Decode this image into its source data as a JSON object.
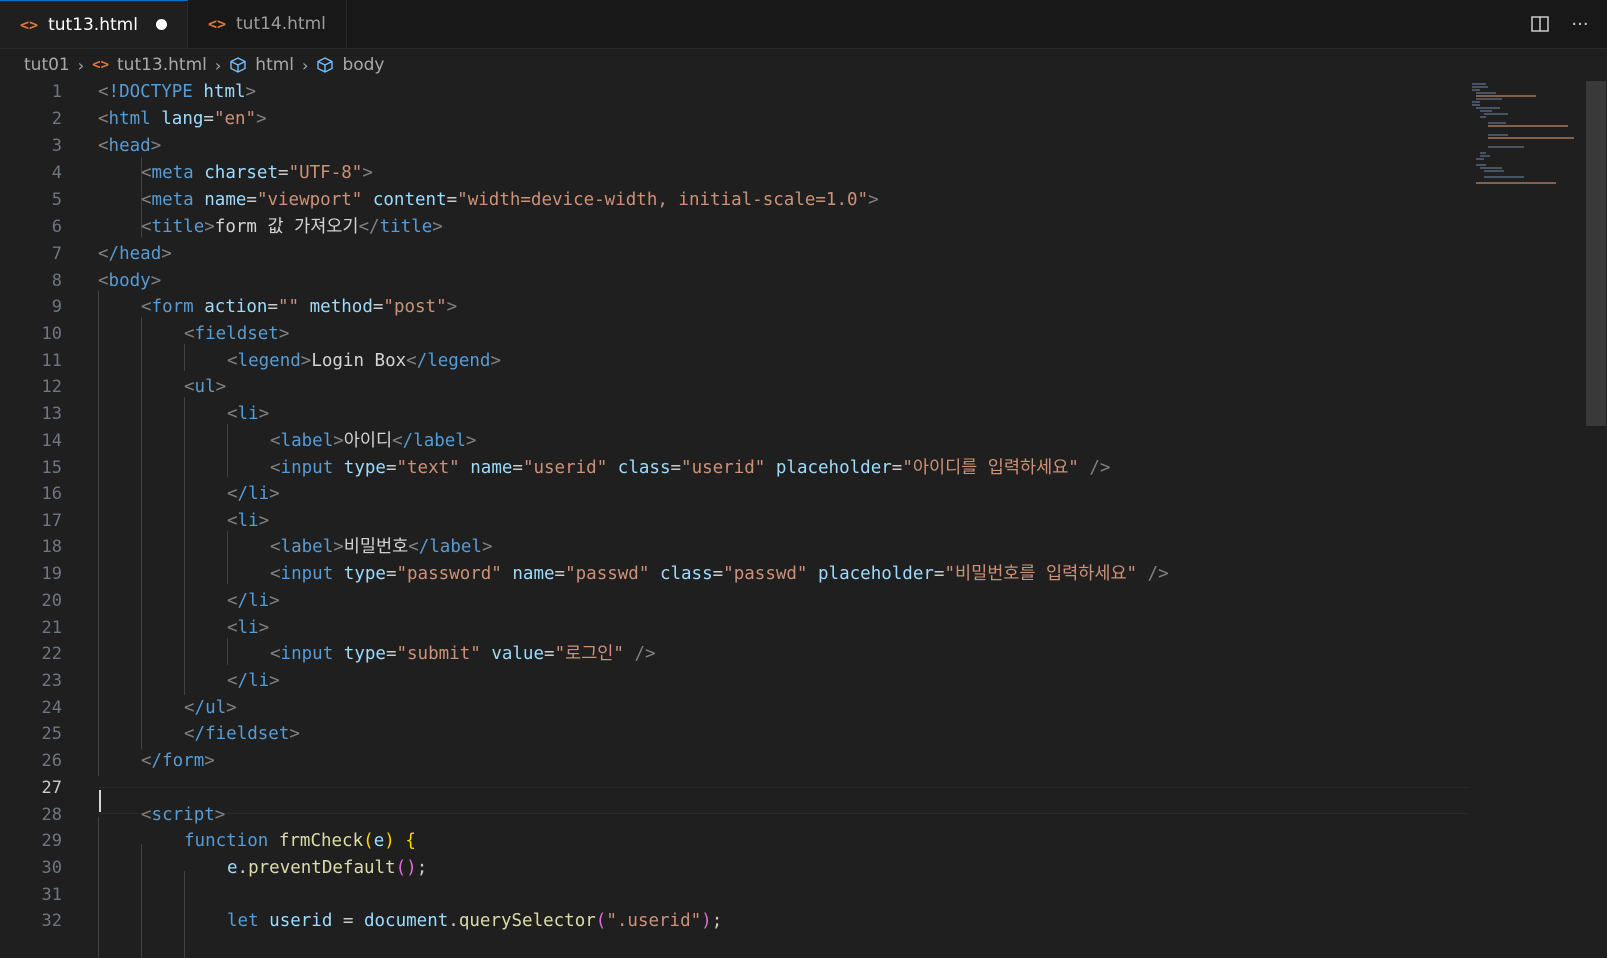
{
  "tabs": [
    {
      "label": "tut13.html",
      "active": true,
      "dirty": true,
      "icon": "html-file-icon"
    },
    {
      "label": "tut14.html",
      "active": false,
      "dirty": false,
      "icon": "html-file-icon"
    }
  ],
  "actions": {
    "split_icon": "split-editor-icon",
    "more_label": "···"
  },
  "breadcrumb": {
    "folder": "tut01",
    "file": "tut13.html",
    "html": "html",
    "body": "body"
  },
  "editor": {
    "current_line": 27,
    "line_numbers": [
      "1",
      "2",
      "3",
      "4",
      "5",
      "6",
      "7",
      "8",
      "9",
      "10",
      "11",
      "12",
      "13",
      "14",
      "15",
      "16",
      "17",
      "18",
      "19",
      "20",
      "21",
      "22",
      "23",
      "24",
      "25",
      "26",
      "27",
      "28",
      "29",
      "30",
      "31",
      "32"
    ],
    "code": {
      "l1a": "!DOCTYPE",
      "l1b": "html",
      "l2a": "html",
      "l2b": "lang",
      "l2c": "\"en\"",
      "l3": "head",
      "l4a": "meta",
      "l4b": "charset",
      "l4c": "\"UTF-8\"",
      "l5a": "meta",
      "l5b": "name",
      "l5c": "\"viewport\"",
      "l5d": "content",
      "l5e": "\"width=device-width, initial-scale=1.0\"",
      "l6a": "title",
      "l6b": "form 값 가져오기",
      "l7": "/head",
      "l8": "body",
      "l9a": "form",
      "l9b": "action",
      "l9c": "\"\"",
      "l9d": "method",
      "l9e": "\"post\"",
      "l10": "fieldset",
      "l11a": "legend",
      "l11b": "Login Box",
      "l11c": "/legend",
      "l12": "ul",
      "l13": "li",
      "l14a": "label",
      "l14b": "아이디",
      "l14c": "/label",
      "l15a": "input",
      "l15b": "type",
      "l15c": "\"text\"",
      "l15d": "name",
      "l15e": "\"userid\"",
      "l15f": "class",
      "l15g": "\"userid\"",
      "l15h": "placeholder",
      "l15i": "\"아이디를 입력하세요\"",
      "l16": "/li",
      "l17": "li",
      "l18a": "label",
      "l18b": "비밀번호",
      "l18c": "/label",
      "l19a": "input",
      "l19b": "type",
      "l19c": "\"password\"",
      "l19d": "name",
      "l19e": "\"passwd\"",
      "l19f": "class",
      "l19g": "\"passwd\"",
      "l19h": "placeholder",
      "l19i": "\"비밀번호를 입력하세요\"",
      "l20": "/li",
      "l21": "li",
      "l22a": "input",
      "l22b": "type",
      "l22c": "\"submit\"",
      "l22d": "value",
      "l22e": "\"로그인\"",
      "l23": "/li",
      "l24": "/ul",
      "l25": "/fieldset",
      "l26": "/form",
      "l28": "script",
      "l29a": "function",
      "l29b": "frmCheck",
      "l29c": "e",
      "l30a": "e",
      "l30b": "preventDefault",
      "l32a": "let",
      "l32b": "userid",
      "l32c": "document",
      "l32d": "querySelector",
      "l32e": "\".userid\""
    }
  }
}
